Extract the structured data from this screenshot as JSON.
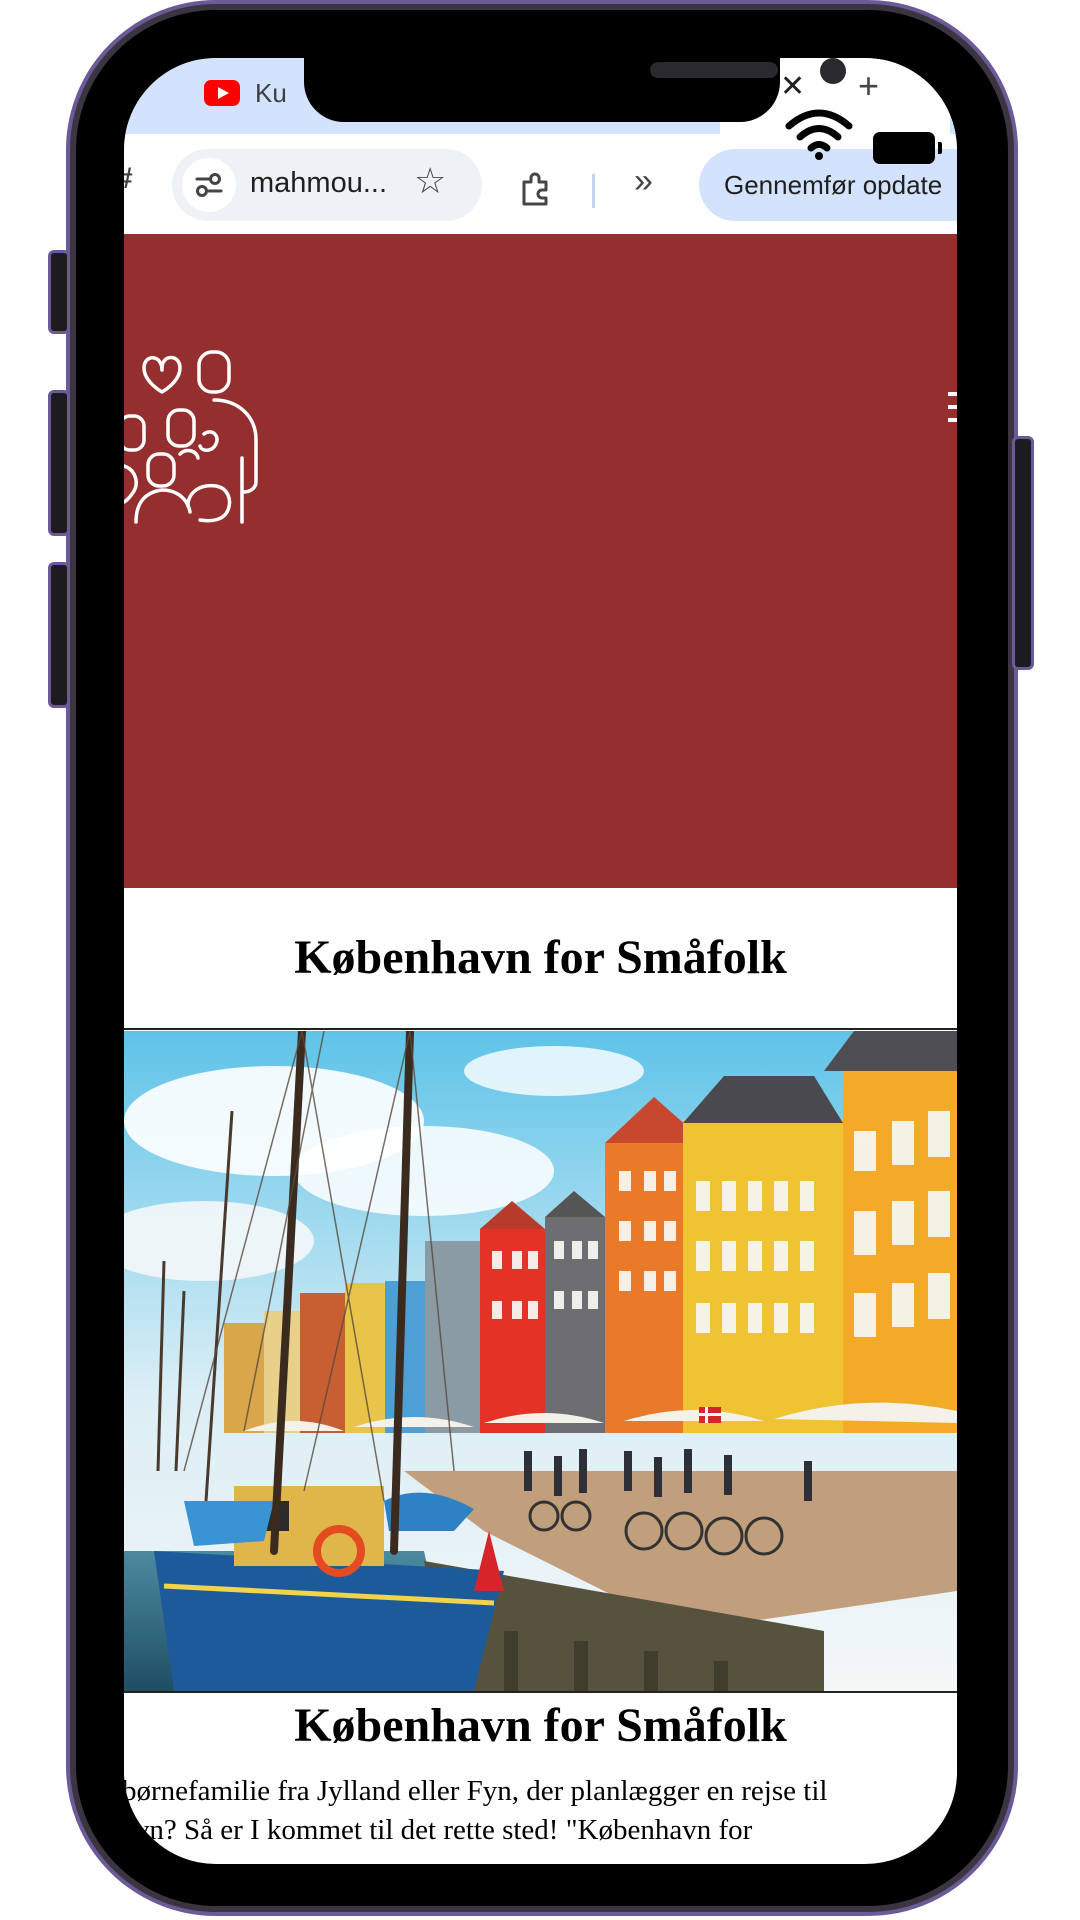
{
  "browser": {
    "tab_title": "Ku",
    "url_display": "mahmou...",
    "update_button_label": "Gennemfør opdate"
  },
  "site": {
    "header_color": "#952f2f",
    "logo": "family-heart-logo",
    "page_heading": "København for Småfolk",
    "hero_image": "Nyhavn harbor with colorful houses and sailing boats",
    "article": {
      "title": "København for Småfolk",
      "body_line_1": "børnefamilie fra Jylland eller Fyn, der planlægger en rejse til",
      "body_line_2": "avn? Så er I kommet til det rette sted! \"København for"
    }
  },
  "icons": {
    "wifi": "wifi-icon",
    "battery": "battery-icon",
    "star": "star-icon",
    "extensions": "extensions-icon",
    "more": "chevron-double-right-icon",
    "close": "close-icon",
    "new_tab": "plus-icon"
  }
}
